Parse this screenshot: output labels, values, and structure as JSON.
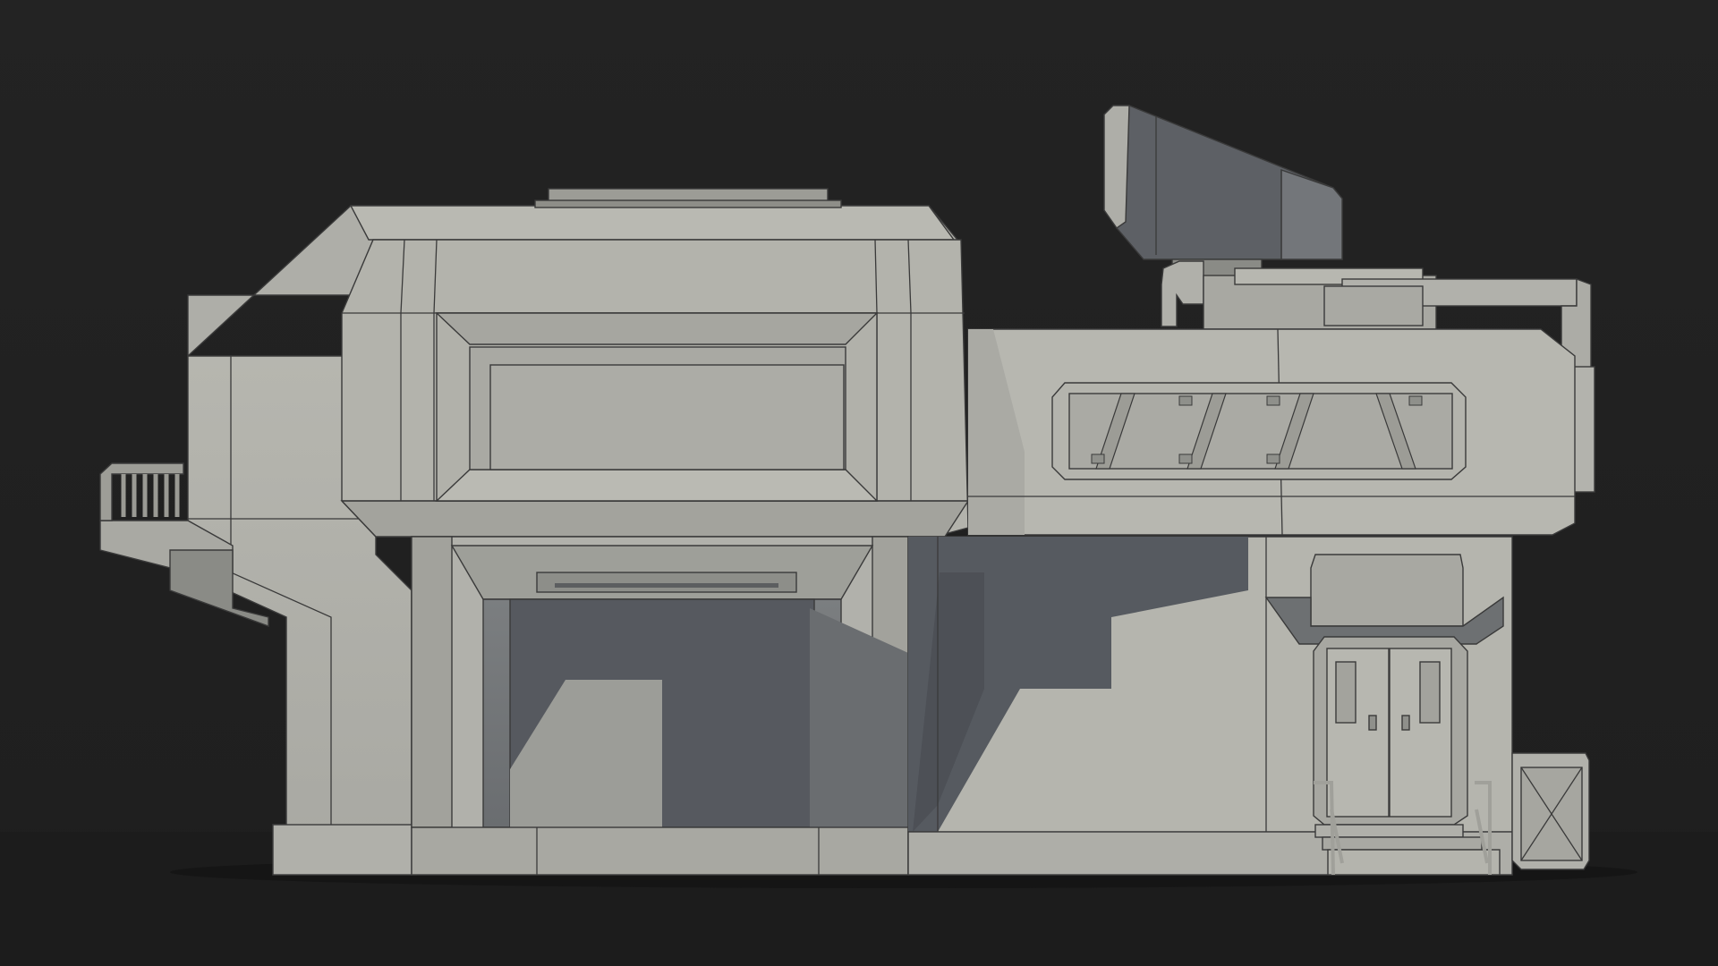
{
  "scene": {
    "type": "3d-render-wireframe-on-shaded",
    "subject": "sci-fi building",
    "colors": {
      "background": "#202020",
      "ground": "#1b1b1b",
      "clay_light": "#b3b3ac",
      "clay_mid": "#a5a5a0",
      "clay_shade": "#8f9089",
      "clay_dark": "#6b6d6a",
      "shadow_blue": "#56595f",
      "shadow_deep": "#4b4e54",
      "wire": "#3a3a3a"
    }
  }
}
